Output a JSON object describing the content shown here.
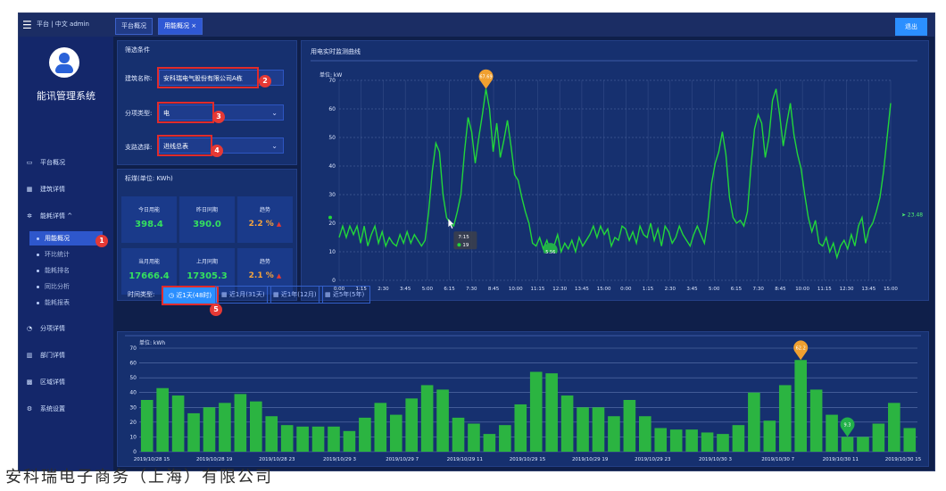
{
  "topbar": {
    "menu_icon": "hamburger-icon",
    "user_line": "平台 | 中文 admin",
    "tabs": [
      {
        "label": "平台概况"
      },
      {
        "label": "用能概况 ×"
      }
    ],
    "logout_label": "退出"
  },
  "sidebar": {
    "system_name": "能讯管理系统",
    "items": [
      {
        "label": "平台概况",
        "icon": "monitor-icon"
      },
      {
        "label": "建筑详情",
        "icon": "building-icon"
      },
      {
        "label": "能耗详情 ^",
        "icon": "network-icon"
      },
      {
        "label": "用能概况",
        "icon": "dot"
      },
      {
        "label": "环比统计",
        "icon": "dot"
      },
      {
        "label": "能耗排名",
        "icon": "dot"
      },
      {
        "label": "同比分析",
        "icon": "dot"
      },
      {
        "label": "能耗报表",
        "icon": "dot"
      },
      {
        "label": "分项详情",
        "icon": "gauge-icon"
      },
      {
        "label": "部门详情",
        "icon": "org-icon"
      },
      {
        "label": "区域详情",
        "icon": "region-icon"
      },
      {
        "label": "系统设置",
        "icon": "settings-icon"
      }
    ]
  },
  "filter": {
    "title": "筛选条件",
    "building_label": "建筑名称:",
    "building_value": "安科瑞电气股份有限公司A栋",
    "category_label": "分项类型:",
    "category_value": "电",
    "circuit_label": "支路选择:",
    "circuit_value": "进线总表"
  },
  "stats": {
    "title": "标煤(单位: KWh)",
    "cells": [
      {
        "label": "今日用能",
        "value": "398.4",
        "kind": "value"
      },
      {
        "label": "昨日同期",
        "value": "390.0",
        "kind": "value"
      },
      {
        "label": "趋势",
        "value": "2.2 %",
        "kind": "trend"
      },
      {
        "label": "当月用能",
        "value": "17666.4",
        "kind": "value"
      },
      {
        "label": "上月同期",
        "value": "17305.3",
        "kind": "value"
      },
      {
        "label": "趋势",
        "value": "2.1 %",
        "kind": "trend"
      }
    ]
  },
  "range": {
    "label": "时间类型:",
    "buttons": [
      {
        "label": "近1天(48时)",
        "icon": "clock-icon"
      },
      {
        "label": "近1月(31天)",
        "icon": "calendar-icon"
      },
      {
        "label": "近1年(12月)",
        "icon": "calendar-icon"
      },
      {
        "label": "近5年(5年)",
        "icon": "calendar-icon"
      }
    ]
  },
  "markers": [
    "1",
    "2",
    "3",
    "4",
    "5"
  ],
  "colors": {
    "accent": "#2b8fff",
    "line": "#22d63a",
    "bar": "#2bb441",
    "marker_red": "#e53935",
    "pin_orange": "#f0a030",
    "pin_green": "#22b04a"
  },
  "chart_data": [
    {
      "type": "line",
      "title": "用电实时监测曲线",
      "ylabel": "单位: kW",
      "ylim": [
        0,
        70
      ],
      "yticks": [
        0,
        10,
        20,
        30,
        40,
        50,
        60,
        70
      ],
      "x_labels": [
        "0:00",
        "1:15",
        "2:30",
        "3:45",
        "5:00",
        "6:15",
        "7:30",
        "8:45",
        "10:00",
        "11:15",
        "12:30",
        "13:45",
        "15:00",
        "0:00",
        "1:15",
        "2:30",
        "3:45",
        "5:00",
        "6:15",
        "7:30",
        "8:45",
        "10:00",
        "11:15",
        "12:30",
        "13:45",
        "15:00"
      ],
      "series": [
        {
          "values": [
            15,
            19,
            15,
            19,
            16,
            19,
            13,
            19,
            12,
            16,
            19,
            13,
            17,
            12,
            15,
            13,
            12,
            16,
            13,
            17,
            13,
            16,
            14,
            12,
            14,
            24,
            38,
            48,
            45,
            30,
            22,
            20,
            19,
            24,
            30,
            45,
            57,
            52,
            41,
            50,
            58,
            67,
            60,
            45,
            55,
            43,
            49,
            56,
            47,
            37,
            35,
            29,
            24,
            20,
            13,
            12,
            15,
            11,
            14,
            10,
            12,
            16,
            10,
            13,
            11,
            14,
            10,
            15,
            12,
            14,
            16,
            19,
            15,
            19,
            16,
            18,
            12,
            15,
            14,
            19,
            18,
            14,
            17,
            13,
            19,
            16,
            15,
            20,
            14,
            18,
            12,
            19,
            17,
            13,
            15,
            19,
            16,
            14,
            12,
            16,
            19,
            16,
            13,
            21,
            34,
            41,
            45,
            52,
            44,
            29,
            22,
            20,
            21,
            19,
            24,
            40,
            53,
            58,
            55,
            43,
            50,
            63,
            67,
            58,
            47,
            55,
            62,
            51,
            44,
            39,
            30,
            22,
            17,
            21,
            13,
            12,
            15,
            10,
            13,
            8,
            12,
            14,
            11,
            16,
            12,
            19,
            22,
            13,
            18,
            20,
            24,
            29,
            38,
            50,
            62
          ]
        }
      ],
      "annotations": {
        "max_label": "67.69",
        "min_label": "5.56",
        "tooltip_time": "7:15",
        "tooltip_value": "19",
        "end_value": "23.48"
      }
    },
    {
      "type": "bar",
      "ylabel": "单位: kWh",
      "ylim": [
        0,
        70
      ],
      "yticks": [
        0,
        10,
        20,
        30,
        40,
        50,
        60,
        70
      ],
      "x_labels": [
        "2019/10/28 15",
        "2019/10/28 19",
        "2019/10/28 23",
        "2019/10/29 3",
        "2019/10/29 7",
        "2019/10/29 11",
        "2019/10/29 15",
        "2019/10/29 19",
        "2019/10/29 23",
        "2019/10/30 3",
        "2019/10/30 7",
        "2019/10/30 11",
        "2019/10/30 15"
      ],
      "values": [
        35,
        43,
        38,
        26,
        30,
        33,
        39,
        34,
        24,
        18,
        17,
        17,
        17,
        14,
        23,
        33,
        25,
        36,
        45,
        42,
        23,
        19,
        12,
        18,
        32,
        54,
        53,
        38,
        30,
        30,
        24,
        35,
        24,
        16,
        15,
        15,
        13,
        12,
        18,
        40,
        21,
        45,
        62,
        42,
        25,
        10,
        10,
        19,
        33,
        16
      ],
      "annotations": {
        "max_label": "62.2",
        "min_label": "9.3"
      }
    }
  ]
}
